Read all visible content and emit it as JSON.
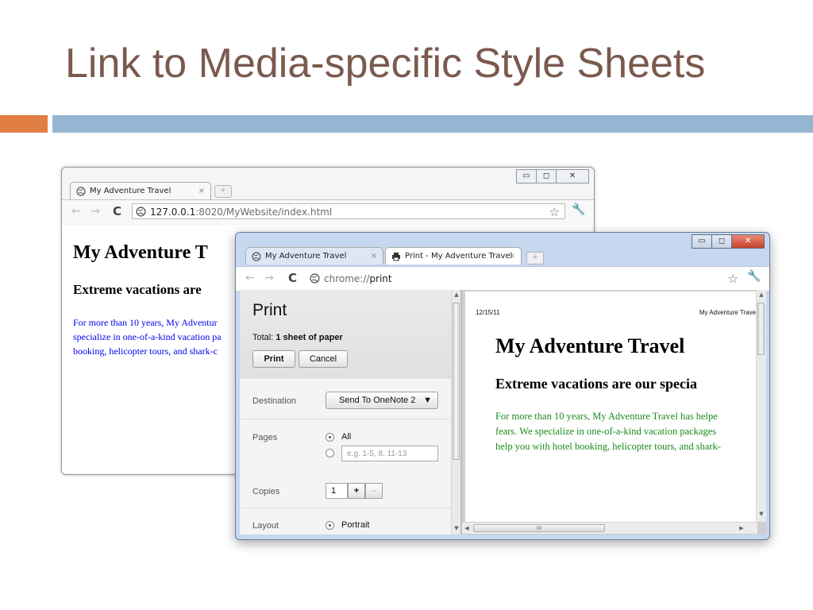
{
  "slide": {
    "title": "Link to Media-specific Style Sheets",
    "accent_colors": {
      "orange": "#e07e43",
      "blue": "#94b6d2"
    }
  },
  "back_window": {
    "tab_label": "My Adventure Travel",
    "tab_close": "×",
    "url_host": "127.0.0.1",
    "url_rest": ":8020/MyWebsite/index.html",
    "page": {
      "heading": "My Adventure T",
      "subheading": "Extreme vacations are",
      "para_lines": [
        "For more than 10 years, My Adventur",
        "specialize in one-of-a-kind vacation pa",
        "booking, helicopter tours, and shark-c"
      ],
      "text_color": "#0000ee"
    },
    "controls": {
      "minimize": "▭",
      "maximize": "◻",
      "close": "✕"
    }
  },
  "front_window": {
    "tabs": [
      {
        "label": "My Adventure Travel",
        "close": "×",
        "icon": "globe-icon"
      },
      {
        "label": "Print - My Adventure Travel",
        "close": "×",
        "icon": "printer-icon"
      }
    ],
    "url_scheme": "chrome://",
    "url_path": "print",
    "controls": {
      "minimize": "▭",
      "maximize": "◻",
      "close": "✕"
    },
    "print": {
      "title": "Print",
      "total_label": "Total:",
      "total_value": "1 sheet of paper",
      "print_button": "Print",
      "cancel_button": "Cancel",
      "destination_label": "Destination",
      "destination_value": "Send To OneNote 2",
      "pages_label": "Pages",
      "pages_all": "All",
      "pages_placeholder": "e.g. 1-5, 8, 11-13",
      "copies_label": "Copies",
      "copies_value": "1",
      "copies_plus": "+",
      "copies_minus": "–",
      "layout_label": "Layout",
      "layout_value": "Portrait"
    },
    "preview": {
      "date": "12/15/11",
      "header_title": "My Adventure Trave",
      "heading": "My Adventure Travel",
      "subheading": "Extreme vacations are our specia",
      "para_lines": [
        "For more than 10 years, My Adventure Travel has helpe",
        "fears. We specialize in one-of-a-kind vacation packages",
        "help you with hotel booking, helicopter tours, and shark-"
      ],
      "text_color": "#1a8a1a",
      "hscroll_grip": "III"
    }
  }
}
